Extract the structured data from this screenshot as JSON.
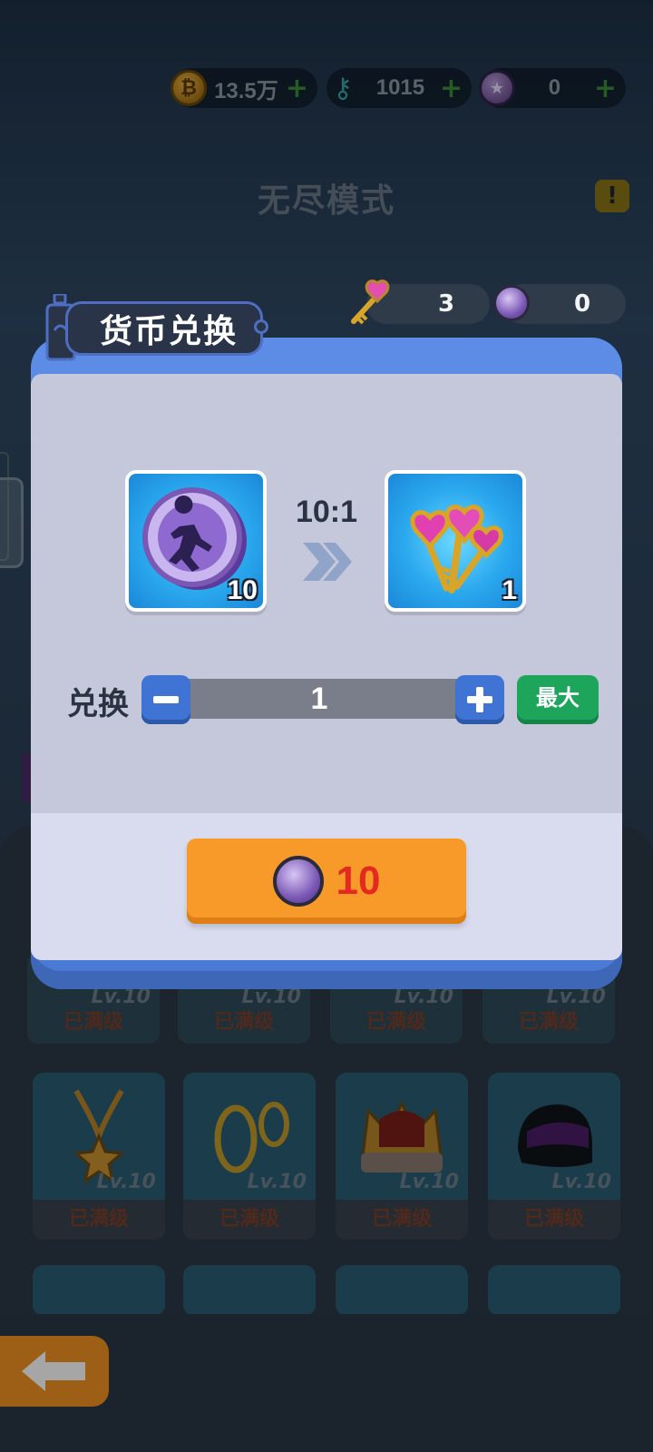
{
  "top_currency": [
    {
      "icon": "gold-coin-icon",
      "value": "13.5万"
    },
    {
      "icon": "key-icon",
      "value": "1015"
    },
    {
      "icon": "purple-coin-icon",
      "value": "0"
    }
  ],
  "mode_title": "无尽模式",
  "warning_icon": "!",
  "grid": {
    "level_label": "Lv.10",
    "status_label": "已满级",
    "items": [
      {
        "icon": "chain-star-necklace-icon"
      },
      {
        "icon": "gold-rings-icon"
      },
      {
        "icon": "crown-icon"
      },
      {
        "icon": "helmet-icon"
      }
    ]
  },
  "dialog": {
    "title": "货币兑换",
    "balance": {
      "keys": "3",
      "coins": "0"
    },
    "from_item": {
      "icon": "purple-runner-coin-icon",
      "count": "10"
    },
    "to_item": {
      "icon": "heart-keys-icon",
      "count": "1"
    },
    "ratio": "10:1",
    "exchange_label": "兑换",
    "quantity": "1",
    "max_label": "最大",
    "price": "10"
  },
  "colors": {
    "accent": "#4a7ad6",
    "buy": "#f89a2a",
    "price": "#e22a20",
    "max": "#1ea55c"
  }
}
